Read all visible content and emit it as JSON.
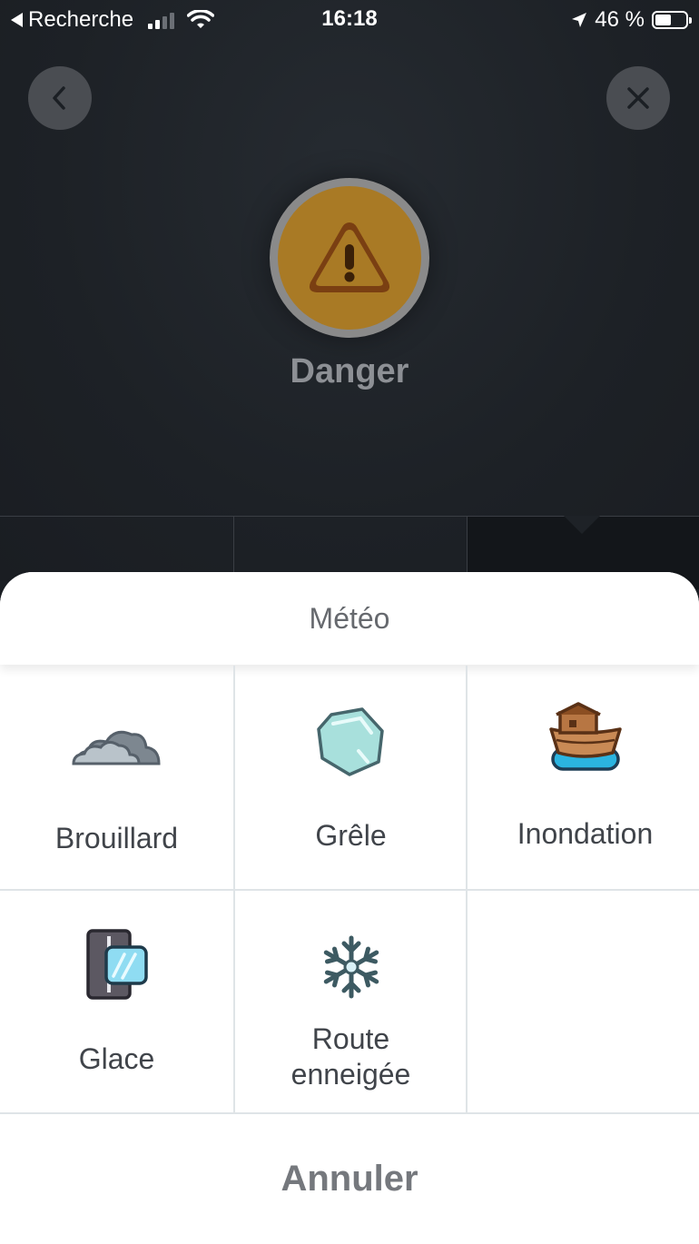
{
  "status_bar": {
    "back_app": "Recherche",
    "time": "16:18",
    "battery": "46 %"
  },
  "alert": {
    "title": "Danger"
  },
  "sheet": {
    "title": "Météo",
    "items": [
      {
        "label": "Brouillard",
        "icon": "fog-icon"
      },
      {
        "label": "Grêle",
        "icon": "hail-icon"
      },
      {
        "label": "Inondation",
        "icon": "flood-ark-icon"
      },
      {
        "label": "Glace",
        "icon": "ice-road-icon"
      },
      {
        "label": "Route enneigée",
        "icon": "snowflake-icon"
      }
    ],
    "cancel_label": "Annuler"
  },
  "colors": {
    "accent_danger": "#a97a25",
    "sheet_bg": "#ffffff",
    "app_bg": "#1b1f24"
  }
}
